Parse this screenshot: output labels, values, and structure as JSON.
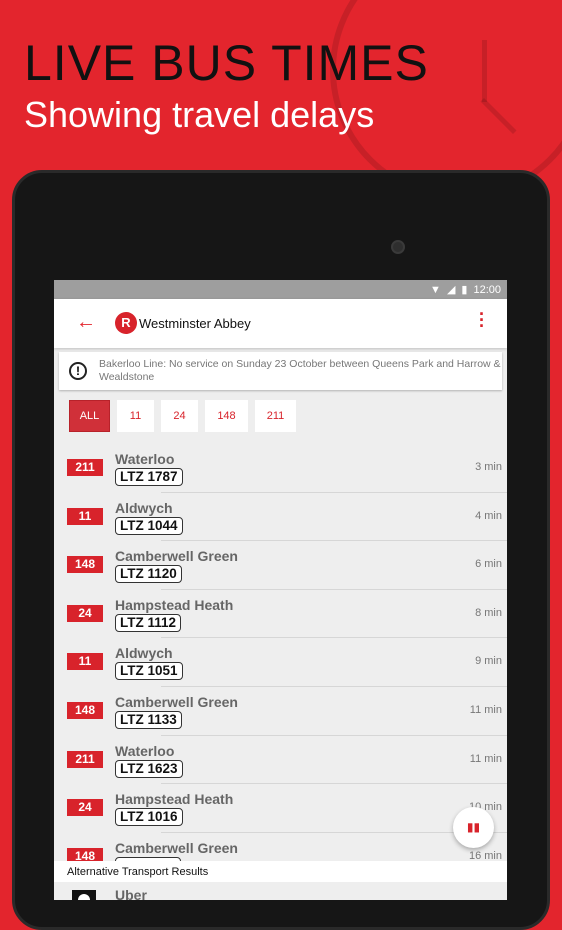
{
  "promo": {
    "headline": "LIVE BUS TIMES",
    "subheadline": "Showing travel delays"
  },
  "status_bar": {
    "time": "12:00"
  },
  "toolbar": {
    "logo_letter": "R",
    "title": "Westminster Abbey"
  },
  "alert": {
    "text": "Bakerloo Line: No service on Sunday 23 October between Queens Park and Harrow & Wealdstone"
  },
  "filters": [
    {
      "label": "ALL",
      "active": true
    },
    {
      "label": "11"
    },
    {
      "label": "24"
    },
    {
      "label": "148"
    },
    {
      "label": "211"
    }
  ],
  "departures": [
    {
      "route": "211",
      "destination": "Waterloo",
      "plate": "LTZ 1787",
      "time": "3 min"
    },
    {
      "route": "11",
      "destination": "Aldwych",
      "plate": "LTZ 1044",
      "time": "4 min"
    },
    {
      "route": "148",
      "destination": "Camberwell Green",
      "plate": "LTZ 1120",
      "time": "6 min"
    },
    {
      "route": "24",
      "destination": "Hampstead Heath",
      "plate": "LTZ 1112",
      "time": "8 min"
    },
    {
      "route": "11",
      "destination": "Aldwych",
      "plate": "LTZ 1051",
      "time": "9 min"
    },
    {
      "route": "148",
      "destination": "Camberwell Green",
      "plate": "LTZ 1133",
      "time": "11 min"
    },
    {
      "route": "211",
      "destination": "Waterloo",
      "plate": "LTZ 1623",
      "time": "11 min"
    },
    {
      "route": "24",
      "destination": "Hampstead Heath",
      "plate": "LTZ 1016",
      "time": "10 min"
    },
    {
      "route": "148",
      "destination": "Camberwell Green",
      "plate": "",
      "time": "16 min"
    }
  ],
  "alternative": {
    "header": "Alternative Transport Results",
    "items": [
      {
        "name": "Uber"
      }
    ]
  },
  "colors": {
    "brand": "#e3252d",
    "accent": "#d8232b"
  },
  "fab": {
    "icon": "map-icon"
  }
}
